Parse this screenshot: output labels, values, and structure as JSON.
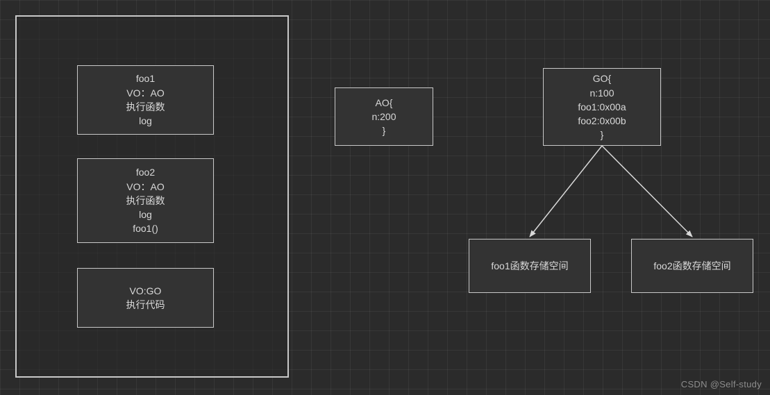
{
  "stack": {
    "foo1": {
      "l1": "foo1",
      "l2": "VO：AO",
      "l3": "执行函数",
      "l4": "log"
    },
    "foo2": {
      "l1": "foo2",
      "l2": "VO：AO",
      "l3": "执行函数",
      "l4": "log",
      "l5": "foo1()"
    },
    "global": {
      "l1": "VO:GO",
      "l2": "执行代码"
    }
  },
  "ao": {
    "l1": "AO{",
    "l2": "n:200",
    "l3": "}"
  },
  "go": {
    "l1": "GO{",
    "l2": "n:100",
    "l3": "foo1:0x00a",
    "l4": "foo2:0x00b",
    "l5": "}"
  },
  "foo1_store": "foo1函数存储空间",
  "foo2_store": "foo2函数存储空间",
  "watermark": "CSDN @Self-study"
}
